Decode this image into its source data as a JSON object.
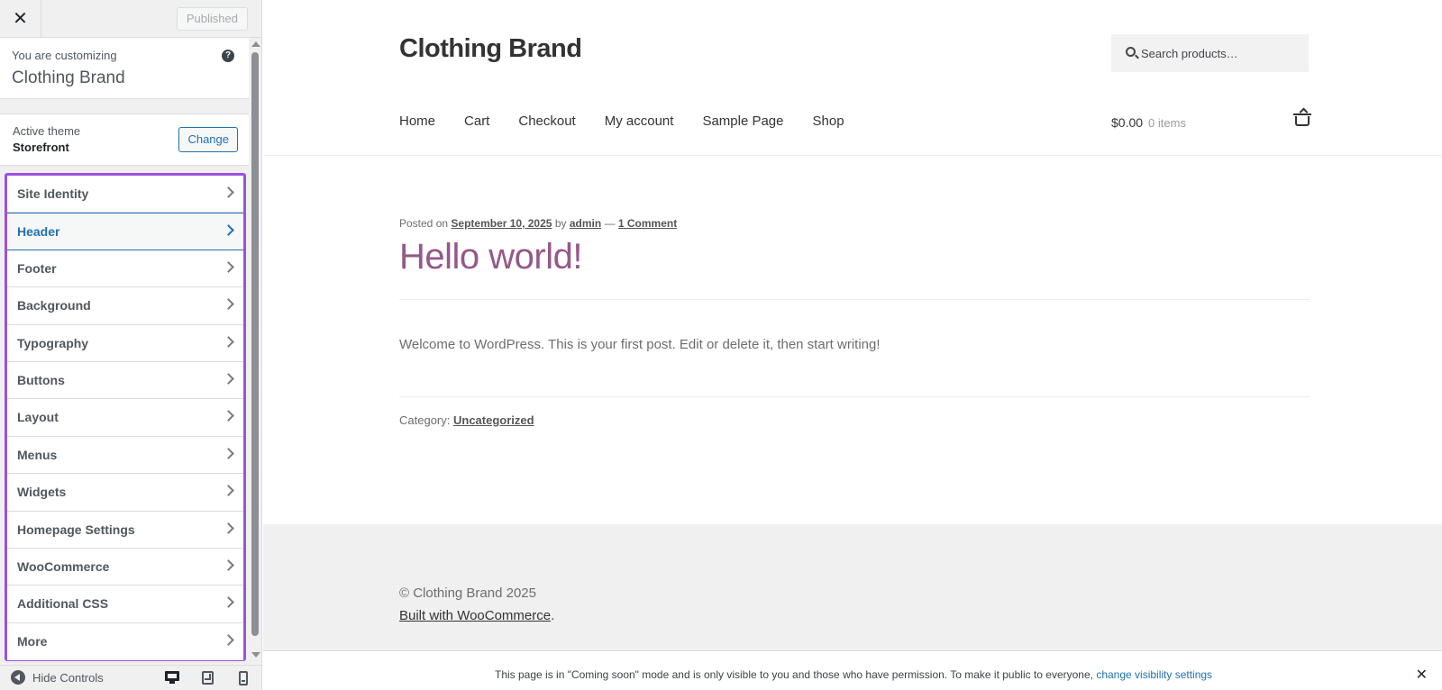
{
  "sidebar": {
    "close_symbol": "✕",
    "published_label": "Published",
    "customizing_label": "You are customizing",
    "site_name": "Clothing Brand",
    "help_symbol": "?",
    "active_theme_label": "Active theme",
    "active_theme_name": "Storefront",
    "change_label": "Change",
    "panels": [
      {
        "label": "Site Identity"
      },
      {
        "label": "Header"
      },
      {
        "label": "Footer"
      },
      {
        "label": "Background"
      },
      {
        "label": "Typography"
      },
      {
        "label": "Buttons"
      },
      {
        "label": "Layout"
      },
      {
        "label": "Menus"
      },
      {
        "label": "Widgets"
      },
      {
        "label": "Homepage Settings"
      },
      {
        "label": "WooCommerce"
      },
      {
        "label": "Additional CSS"
      },
      {
        "label": "More"
      }
    ],
    "active_panel": "Header",
    "hide_controls_label": "Hide Controls",
    "icons": [
      "close-icon",
      "help-icon",
      "chevron-right-icon",
      "hide-controls-icon",
      "desktop-icon",
      "tablet-icon",
      "mobile-icon"
    ]
  },
  "preview": {
    "site_title": "Clothing Brand",
    "search_placeholder": "Search products…",
    "nav": [
      "Home",
      "Cart",
      "Checkout",
      "My account",
      "Sample Page",
      "Shop"
    ],
    "cart_amount": "$0.00",
    "cart_count": "0 items",
    "post": {
      "meta_prefix": "Posted on",
      "date": "September 10, 2025",
      "by_label": "by",
      "author": "admin",
      "dash": "—",
      "comments": "1 Comment",
      "title": "Hello world!",
      "body": "Welcome to WordPress. This is your first post. Edit or delete it, then start writing!",
      "category_label": "Category:",
      "category": "Uncategorized"
    },
    "footer": {
      "copyright": "© Clothing Brand 2025",
      "built_with": "Built with WooCommerce",
      "built_suffix": "."
    },
    "coming_soon": {
      "text": "This page is in \"Coming soon\" mode and is only visible to you and those who have permission. To make it public to everyone, ",
      "link": "change visibility settings",
      "close_symbol": "✕"
    }
  },
  "colors": {
    "accent": "#2271b1",
    "highlight_border": "#9b51e0",
    "post_title": "#96588a"
  }
}
